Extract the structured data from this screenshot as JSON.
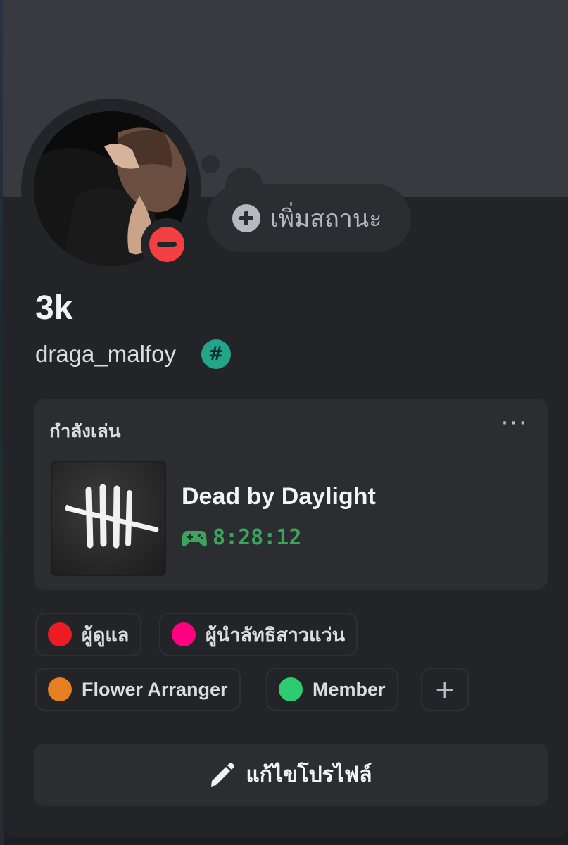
{
  "profile": {
    "display_name": "3k",
    "username": "draga_malfoy",
    "badge_icon": "hashtag-badge-icon",
    "status_button_label": "เพิ่มสถานะ",
    "status_indicator": "do-not-disturb",
    "status_color": "#f23f43"
  },
  "activity": {
    "header": "กำลังเล่น",
    "game_title": "Dead by Daylight",
    "elapsed": "8:28:12",
    "game_icon": "gamepad-icon",
    "elapsed_color": "#3ba55d"
  },
  "roles": [
    {
      "label": "ผู้ดูแล",
      "color": "#ed1c24"
    },
    {
      "label": "ผู้นำลัทธิสาวแว่น",
      "color": "#ff0080"
    },
    {
      "label": "Flower Arranger",
      "color": "#e67e22"
    },
    {
      "label": "Member",
      "color": "#2ecc71"
    }
  ],
  "edit_profile_label": "แก้ไขโปรไฟล์",
  "colors": {
    "banner": "#383a40",
    "card": "#232428",
    "panel": "#2b2d31",
    "badge": "#23a58b"
  }
}
